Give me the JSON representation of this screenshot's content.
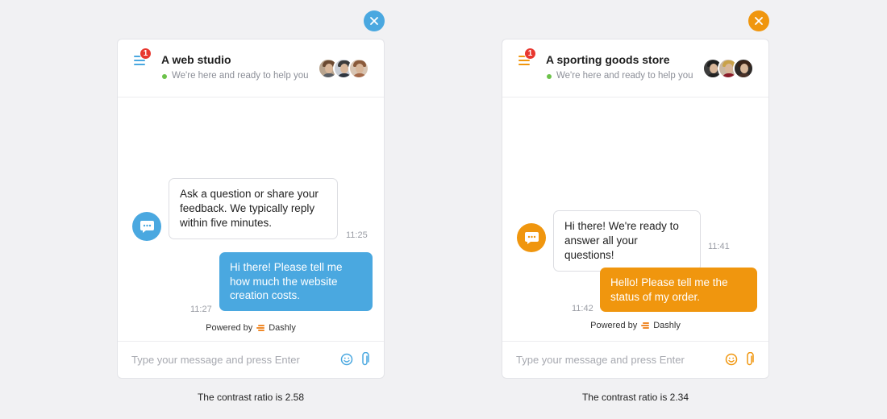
{
  "widgets": [
    {
      "accent": "#4aa8e0",
      "badge_count": "1",
      "title": "A web studio",
      "status": "We're here and ready to help you",
      "incoming_message": "Ask a question or share your feedback. We typically reply within five minutes.",
      "incoming_time": "11:25",
      "outgoing_message": "Hi there! Please tell me how much the website creation costs.",
      "outgoing_time": "11:27",
      "powered_prefix": "Powered by",
      "powered_brand": "Dashly",
      "input_placeholder": "Type your message and press Enter",
      "caption": "The contrast ratio is 2.58",
      "icons": [
        "close-icon",
        "menu-icon",
        "chat-icon",
        "emoji-icon",
        "paperclip-icon"
      ]
    },
    {
      "accent": "#f0960e",
      "badge_count": "1",
      "title": "A sporting goods store",
      "status": "We're here and ready to help you",
      "incoming_message": "Hi there! We're ready to answer all your questions!",
      "incoming_time": "11:41",
      "outgoing_message": "Hello! Please tell me the status of my order.",
      "outgoing_time": "11:42",
      "powered_prefix": "Powered by",
      "powered_brand": "Dashly",
      "input_placeholder": "Type your message and press Enter",
      "caption": "The contrast ratio is 2.34",
      "icons": [
        "close-icon",
        "menu-icon",
        "chat-icon",
        "emoji-icon",
        "paperclip-icon"
      ]
    }
  ]
}
